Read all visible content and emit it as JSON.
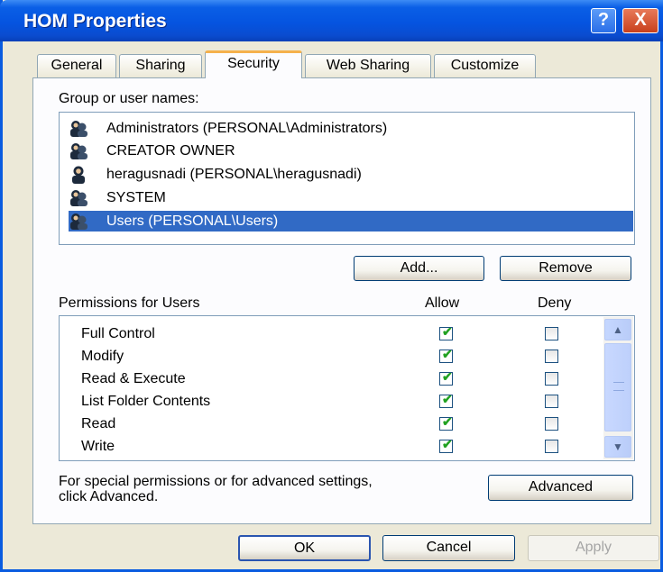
{
  "window": {
    "title": "HOM Properties",
    "help_glyph": "?",
    "close_glyph": "X"
  },
  "tabs": [
    {
      "label": "General"
    },
    {
      "label": "Sharing"
    },
    {
      "label": "Security",
      "active": true
    },
    {
      "label": "Web Sharing"
    },
    {
      "label": "Customize"
    }
  ],
  "security": {
    "group_label": "Group or user names:",
    "users": [
      {
        "name": "Administrators (PERSONAL\\Administrators)",
        "icon": "user-group-icon"
      },
      {
        "name": "CREATOR OWNER",
        "icon": "user-group-icon"
      },
      {
        "name": "heragusnadi (PERSONAL\\heragusnadi)",
        "icon": "user-icon"
      },
      {
        "name": "SYSTEM",
        "icon": "user-group-icon"
      },
      {
        "name": "Users (PERSONAL\\Users)",
        "icon": "user-group-icon",
        "selected": true
      }
    ],
    "add_label": "Add...",
    "remove_label": "Remove",
    "permissions_label": "Permissions for Users",
    "allow_label": "Allow",
    "deny_label": "Deny",
    "permissions": [
      {
        "name": "Full Control",
        "allow": true,
        "deny": false
      },
      {
        "name": "Modify",
        "allow": true,
        "deny": false
      },
      {
        "name": "Read & Execute",
        "allow": true,
        "deny": false
      },
      {
        "name": "List Folder Contents",
        "allow": true,
        "deny": false
      },
      {
        "name": "Read",
        "allow": true,
        "deny": false
      },
      {
        "name": "Write",
        "allow": true,
        "deny": false
      }
    ],
    "advanced_note_line1": "For special permissions or for advanced settings,",
    "advanced_note_line2": "click Advanced.",
    "advanced_label": "Advanced"
  },
  "footer": {
    "ok_label": "OK",
    "cancel_label": "Cancel",
    "apply_label": "Apply"
  },
  "colors": {
    "titlebar": "#0554e0",
    "selection": "#316ac5",
    "dialog_bg": "#ece9d8",
    "check": "#21a121"
  }
}
